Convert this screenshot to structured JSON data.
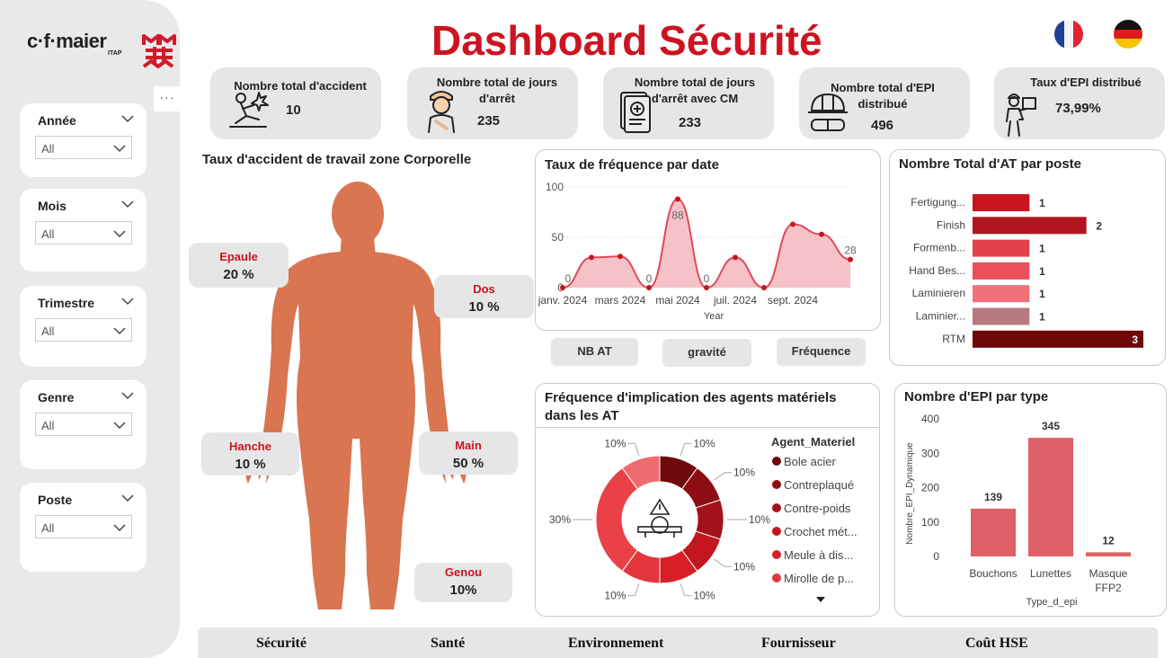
{
  "brand": {
    "logo_text": "c·f·maier",
    "logo_sub": "ITAP"
  },
  "title": "Dashboard Sécurité",
  "more_label": "···",
  "filters": [
    {
      "label": "Année",
      "value": "All"
    },
    {
      "label": "Mois",
      "value": "All"
    },
    {
      "label": "Trimestre",
      "value": "All"
    },
    {
      "label": "Genre",
      "value": "All"
    },
    {
      "label": "Poste",
      "value": "All"
    }
  ],
  "kpis": [
    {
      "label": "Nombre total d'accident",
      "value": "10",
      "icon": "injured-person-icon"
    },
    {
      "label": "Nombre total de jours d'arrêt",
      "value": "235",
      "icon": "bandaged-worker-icon"
    },
    {
      "label": "Nombre total de jours d'arrêt avec CM",
      "value": "233",
      "icon": "medical-certificate-icon"
    },
    {
      "label": "Nombre total d'EPI distribué",
      "value": "496",
      "icon": "helmet-goggles-icon"
    },
    {
      "label": "Taux d'EPI distribué",
      "value": "73,99%",
      "icon": "worker-box-icon"
    }
  ],
  "body_zone": {
    "title": "Taux d'accident de travail zone Corporelle",
    "zones": [
      {
        "name": "Epaule",
        "value": "20 %"
      },
      {
        "name": "Dos",
        "value": "10 %"
      },
      {
        "name": "Hanche",
        "value": "10 %"
      },
      {
        "name": "Main",
        "value": "50 %"
      },
      {
        "name": "Genou",
        "value": "10%"
      }
    ]
  },
  "buttons": {
    "nb_at": "NB AT",
    "gravite": "gravité",
    "frequence": "Fréquence"
  },
  "chart_data": [
    {
      "type": "area",
      "title": "Taux de fréquence par date",
      "xlabel": "Year",
      "ylabel": "",
      "ylim": [
        0,
        100
      ],
      "yticks": [
        "0",
        "50",
        "100"
      ],
      "xticks": [
        "janv. 2024",
        "mars 2024",
        "mai 2024",
        "juil. 2024",
        "sept. 2024"
      ],
      "x": [
        "janv. 2024",
        "févr. 2024",
        "mars 2024",
        "avr. 2024",
        "mai 2024",
        "juin 2024",
        "juil. 2024",
        "août 2024",
        "sept. 2024",
        "oct. 2024",
        "nov. 2024"
      ],
      "values": [
        0,
        30,
        31,
        0,
        88,
        0,
        30,
        0,
        63,
        53,
        28
      ],
      "data_labels": [
        {
          "index": 0,
          "text": "0"
        },
        {
          "index": 3,
          "text": "0"
        },
        {
          "index": 4,
          "text": "88"
        },
        {
          "index": 5,
          "text": "0"
        },
        {
          "index": 10,
          "text": "28"
        }
      ],
      "color": "#e0495b"
    },
    {
      "type": "bar",
      "orientation": "horizontal",
      "title": "Nombre Total d'AT par poste",
      "categories": [
        "Fertigung...",
        "Finish",
        "Formenb...",
        "Hand Bes...",
        "Laminieren",
        "Laminier...",
        "RTM"
      ],
      "values": [
        1,
        2,
        1,
        1,
        1,
        1,
        3
      ],
      "colors": [
        "#c8141f",
        "#b11620",
        "#e2414b",
        "#ea4f5a",
        "#f1717a",
        "#b67a80",
        "#6f0808"
      ]
    },
    {
      "type": "pie",
      "title": "Fréquence d'implication des agents matériels dans les AT",
      "legend_title": "Agent_Materiel",
      "labels": [
        "Bole acier",
        "Contreplaqué",
        "Contre-poids",
        "Crochet mét...",
        "Meule à dis...",
        "Mirolle de p..."
      ],
      "slices": [
        {
          "value": 10,
          "label": "10%",
          "color": "#6e0a0c"
        },
        {
          "value": 10,
          "label": "10%",
          "color": "#8c0e12"
        },
        {
          "value": 10,
          "label": "10%",
          "color": "#a31218"
        },
        {
          "value": 10,
          "label": "10%",
          "color": "#c3161e"
        },
        {
          "value": 10,
          "label": "10%",
          "color": "#d81f27"
        },
        {
          "value": 10,
          "label": "10%",
          "color": "#e2353c"
        },
        {
          "value": 30,
          "label": "30%",
          "color": "#ea4146"
        },
        {
          "value": 10,
          "label": "10%",
          "color": "#ef6a6f"
        }
      ],
      "legend_colors": [
        "#6e0a0c",
        "#8c0e12",
        "#a31218",
        "#c3161e",
        "#d81f27",
        "#e2353c"
      ],
      "more_icon": "triangle-down-icon"
    },
    {
      "type": "bar",
      "title": "Nombre d'EPI par type",
      "xlabel": "Type_d_epi",
      "ylabel": "Nombre_EPI_Dynamique",
      "ylim": [
        0,
        400
      ],
      "yticks": [
        "0",
        "100",
        "200",
        "300",
        "400"
      ],
      "categories": [
        "Bouchons",
        "Lunettes",
        "Masque FFP2"
      ],
      "category_lines": [
        [
          "Bouchons"
        ],
        [
          "Lunettes"
        ],
        [
          "Masque",
          "FFP2"
        ]
      ],
      "values": [
        139,
        345,
        12
      ],
      "color": "#e06068"
    }
  ],
  "nav": [
    "Sécurité",
    "Santé",
    "Environnement",
    "Fournisseur",
    "Coût HSE"
  ]
}
